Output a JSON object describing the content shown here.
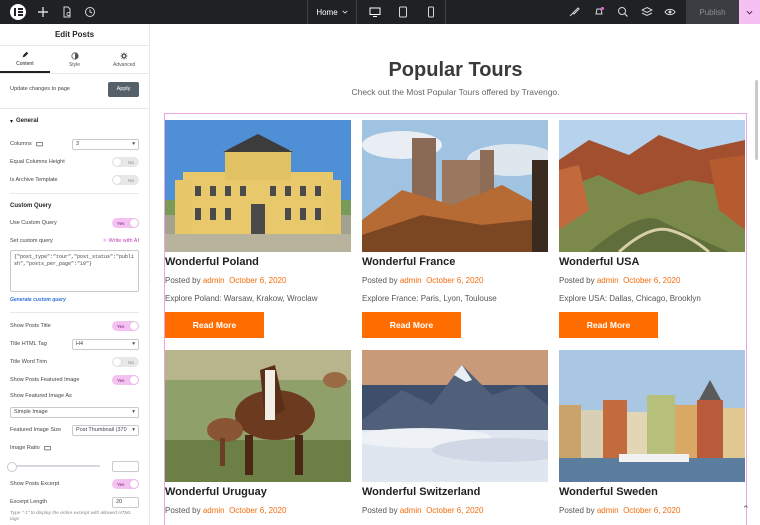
{
  "topbar": {
    "page_name": "Home",
    "publish_label": "Publish"
  },
  "sidebar": {
    "title": "Edit Posts",
    "tabs": [
      {
        "label": "Content",
        "icon": "pencil-icon"
      },
      {
        "label": "Style",
        "icon": "half-circle-icon"
      },
      {
        "label": "Advanced",
        "icon": "gear-icon"
      }
    ],
    "update_label": "Update changes to page",
    "apply_label": "Apply",
    "general_label": "General",
    "columns_label": "Columns",
    "columns_value": "3",
    "equal_columns_label": "Equal Columns Height",
    "equal_columns_state": "No",
    "archive_label": "Is Archive Template",
    "archive_state": "No",
    "custom_query_head": "Custom Query",
    "use_custom_query_label": "Use Custom Query",
    "use_custom_query_state": "Yes",
    "set_custom_query_label": "Set custom query",
    "write_ai_label": "Write with AI",
    "custom_query_value": "{\"post_type\":\"tour\",\"post_status\":\"publish\",\"posts_per_page\":\"10\"}",
    "generate_link": "Generate custom query",
    "show_title_label": "Show Posts Title",
    "show_title_state": "Yes",
    "title_tag_label": "Title HTML Tag",
    "title_tag_value": "H4",
    "title_trim_label": "Title Word Trim",
    "title_trim_state": "No",
    "show_featured_label": "Show Posts Featured Image",
    "show_featured_state": "Yes",
    "featured_as_label": "Show Featured Image As",
    "featured_as_value": "Simple Image",
    "featured_size_label": "Featured Image Size",
    "featured_size_value": "Post Thumbnail (370",
    "ratio_label": "Image Ratio",
    "show_excerpt_label": "Show Posts Excerpt",
    "show_excerpt_state": "Yes",
    "excerpt_length_label": "Excerpt Length",
    "excerpt_length_value": "20",
    "excerpt_hint": "Type \"-1\" to display the entire excerpt with allowed HTML tags"
  },
  "canvas": {
    "title": "Popular Tours",
    "subtitle": "Check out the Most Popular Tours offered by Travengo."
  },
  "tours": [
    {
      "title": "Wonderful Poland",
      "author": "admin",
      "date": "October 6, 2020",
      "excerpt": "Explore Poland: Warsaw, Krakow, Wroclaw",
      "button": "Read More"
    },
    {
      "title": "Wonderful France",
      "author": "admin",
      "date": "October 6, 2020",
      "excerpt": "Explore France: Paris, Lyon, Toulouse",
      "button": "Read More"
    },
    {
      "title": "Wonderful USA",
      "author": "admin",
      "date": "October 6, 2020",
      "excerpt": "Explore USA: Dallas, Chicago, Brooklyn",
      "button": "Read More"
    },
    {
      "title": "Wonderful Uruguay",
      "author": "admin",
      "date": "October 6, 2020"
    },
    {
      "title": "Wonderful Switzerland",
      "author": "admin",
      "date": "October 6, 2020"
    },
    {
      "title": "Wonderful Sweden",
      "author": "admin",
      "date": "October 6, 2020"
    }
  ],
  "meta_prefix": "Posted by",
  "colors": {
    "accent": "#ff6d00",
    "topbar": "#1f2124",
    "toggle_on": "#f5c1f2"
  }
}
